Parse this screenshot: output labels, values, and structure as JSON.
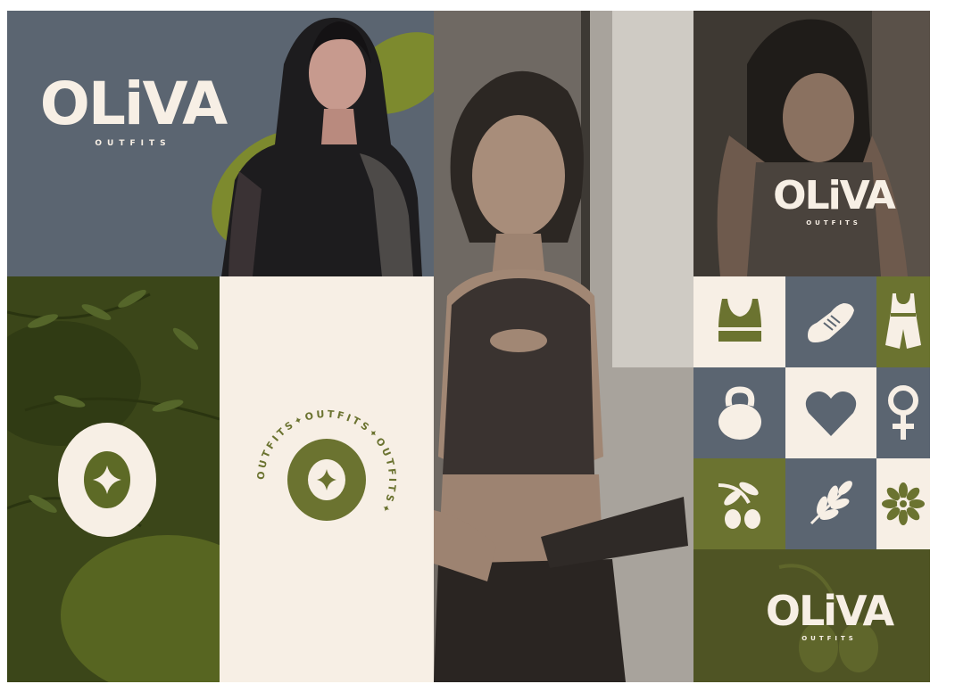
{
  "brand": {
    "name": "OLiVA",
    "tagline": "OUTFITS",
    "badge_ring_text": "OUTFITS✦OUTFITS✦OUTFITS✦"
  },
  "colors": {
    "slate": "#5b6571",
    "olive": "#6b7330",
    "dark_olive": "#4f5424",
    "cream": "#f7efe5",
    "photo_olive": "#3f4a1e"
  },
  "icons": [
    "sports-bra-icon",
    "sneaker-icon",
    "romper-icon",
    "kettlebell-icon",
    "heart-icon",
    "female-symbol-icon",
    "olive-branch-icon",
    "leaf-sprig-icon",
    "flower-icon"
  ]
}
